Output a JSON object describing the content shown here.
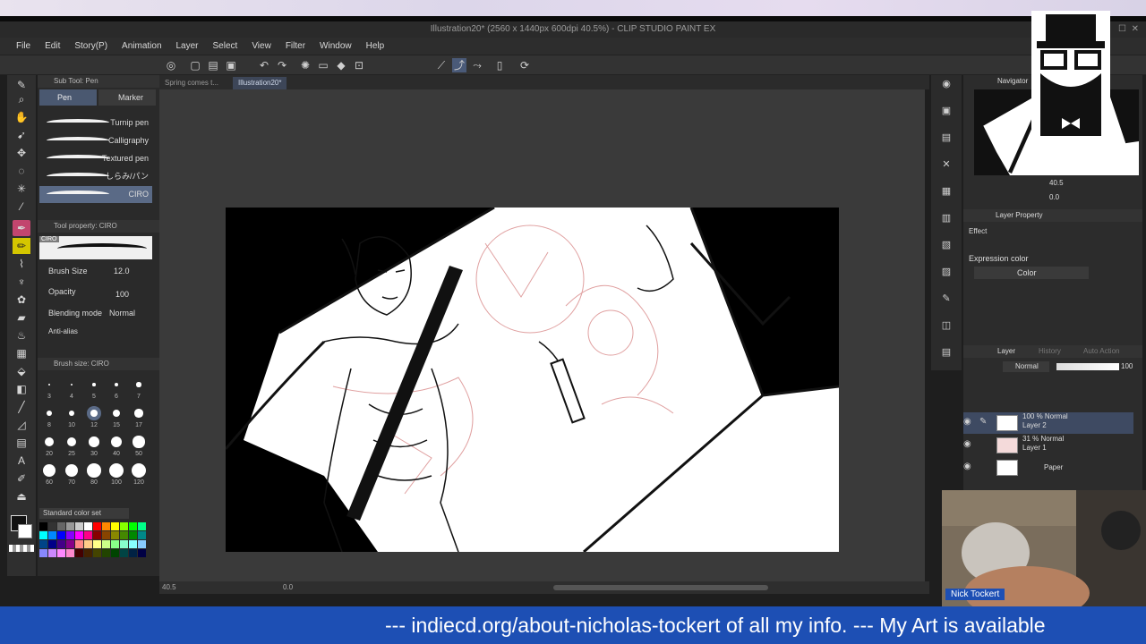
{
  "window": {
    "title": "Illustration20* (2560 x 1440px 600dpi 40.5%)  - CLIP STUDIO PAINT EX"
  },
  "menu": [
    "File",
    "Edit",
    "Story(P)",
    "Animation",
    "Layer",
    "Select",
    "View",
    "Filter",
    "Window",
    "Help"
  ],
  "subtool": {
    "header": "Sub Tool: Pen",
    "tabs": [
      "Pen",
      "Marker"
    ],
    "brushes": [
      "Turnip pen",
      "Calligraphy",
      "Textured pen",
      "しらみ/パン",
      "CIRO"
    ],
    "selected_brush": "CIRO"
  },
  "tool_property": {
    "header": "Tool property: CIRO",
    "preview_label": "CIRO",
    "brush_size_label": "Brush Size",
    "brush_size_value": "12.0",
    "opacity_label": "Opacity",
    "opacity_value": "100",
    "blending_label": "Blending mode",
    "blending_value": "Normal",
    "antialias_label": "Anti-alias"
  },
  "brush_size_panel": {
    "header": "Brush size: CIRO",
    "sizes": [
      "3",
      "4",
      "5",
      "6",
      "7",
      "8",
      "10",
      "12",
      "15",
      "17",
      "20",
      "25",
      "30",
      "40",
      "50",
      "60",
      "70",
      "80",
      "100",
      "120"
    ]
  },
  "color_set": {
    "label": "Standard color set"
  },
  "doc_tabs": [
    "Spring comes t...",
    "Illustration20*"
  ],
  "navigator": {
    "title": "Navigator",
    "zoom": "40.5",
    "angle": "0.0"
  },
  "layer_property": {
    "title": "Layer Property",
    "effect": "Effect",
    "expression_label": "Expression color",
    "expression_value": "Color"
  },
  "layer_panel": {
    "tabs": [
      "Layer",
      "History",
      "Auto Action"
    ],
    "blend": "Normal",
    "opacity": "100",
    "layers": [
      {
        "line1": "100 % Normal",
        "line2": "Layer 2"
      },
      {
        "line1": "31 % Normal",
        "line2": "Layer 1"
      },
      {
        "line1": "",
        "line2": "Paper"
      }
    ]
  },
  "status": {
    "zoom": "40.5",
    "angle": "0.0"
  },
  "webcam": {
    "name": "Nick Tockert"
  },
  "ticker": {
    "text": "--- indiecd.org/about-nicholas-tockert of all my info. --- My Art is available"
  },
  "colors": {
    "accent": "#c2456e",
    "ticker_bg": "#1d4fb4",
    "panel_bg": "#2a2a2a",
    "canvas_bg": "#000000"
  }
}
